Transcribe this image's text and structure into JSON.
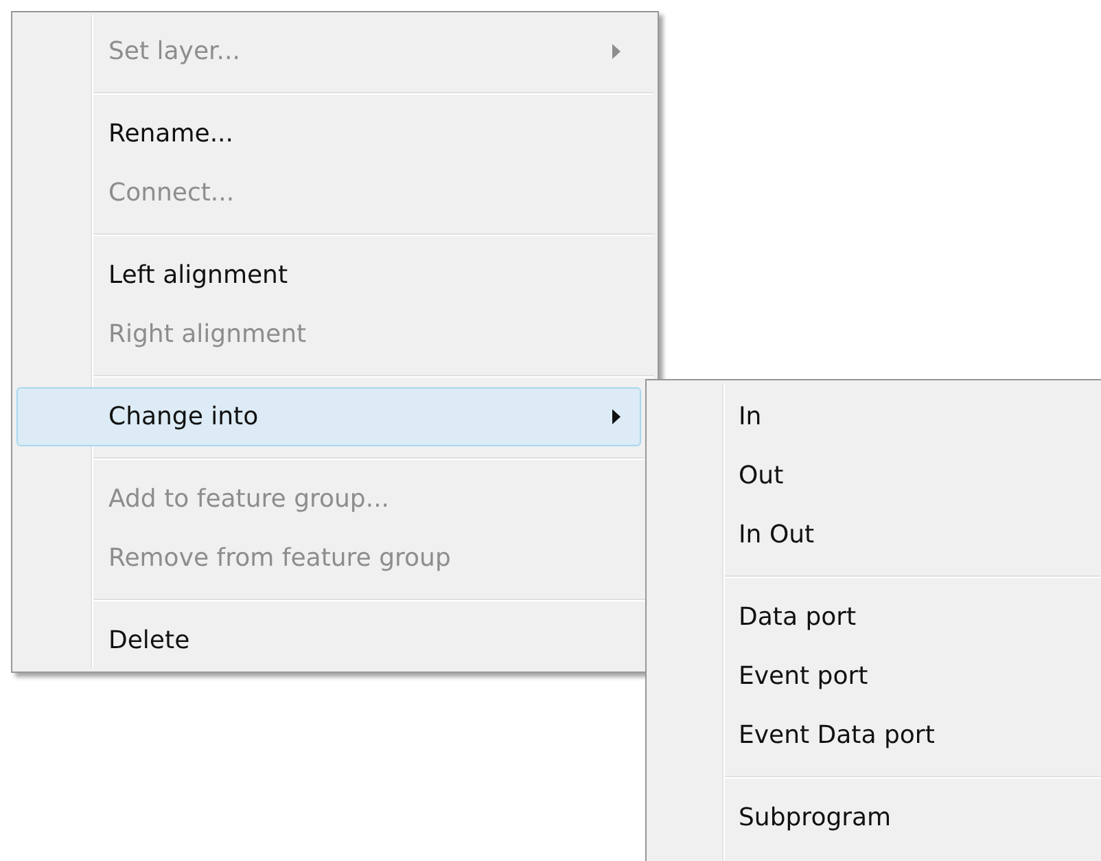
{
  "context_menu": {
    "items": [
      {
        "kind": "item",
        "label": "Set layer...",
        "disabled": true,
        "submenu": true,
        "selected": false
      },
      {
        "kind": "separator"
      },
      {
        "kind": "item",
        "label": "Rename...",
        "disabled": false,
        "submenu": false,
        "selected": false
      },
      {
        "kind": "item",
        "label": "Connect...",
        "disabled": true,
        "submenu": false,
        "selected": false
      },
      {
        "kind": "separator"
      },
      {
        "kind": "item",
        "label": "Left alignment",
        "disabled": false,
        "submenu": false,
        "selected": false
      },
      {
        "kind": "item",
        "label": "Right alignment",
        "disabled": true,
        "submenu": false,
        "selected": false
      },
      {
        "kind": "separator"
      },
      {
        "kind": "item",
        "label": "Change into",
        "disabled": false,
        "submenu": true,
        "selected": true
      },
      {
        "kind": "separator"
      },
      {
        "kind": "item",
        "label": "Add to feature group...",
        "disabled": true,
        "submenu": false,
        "selected": false
      },
      {
        "kind": "item",
        "label": "Remove from feature group",
        "disabled": true,
        "submenu": false,
        "selected": false
      },
      {
        "kind": "separator"
      },
      {
        "kind": "item",
        "label": "Delete",
        "disabled": false,
        "submenu": false,
        "selected": false
      }
    ]
  },
  "submenu": {
    "items": [
      {
        "kind": "item",
        "label": "In",
        "disabled": false
      },
      {
        "kind": "item",
        "label": "Out",
        "disabled": false
      },
      {
        "kind": "item",
        "label": "In Out",
        "disabled": false
      },
      {
        "kind": "separator"
      },
      {
        "kind": "item",
        "label": "Data port",
        "disabled": false
      },
      {
        "kind": "item",
        "label": "Event port",
        "disabled": false
      },
      {
        "kind": "item",
        "label": "Event Data port",
        "disabled": false
      },
      {
        "kind": "separator"
      },
      {
        "kind": "item",
        "label": "Subprogram",
        "disabled": false
      }
    ]
  }
}
